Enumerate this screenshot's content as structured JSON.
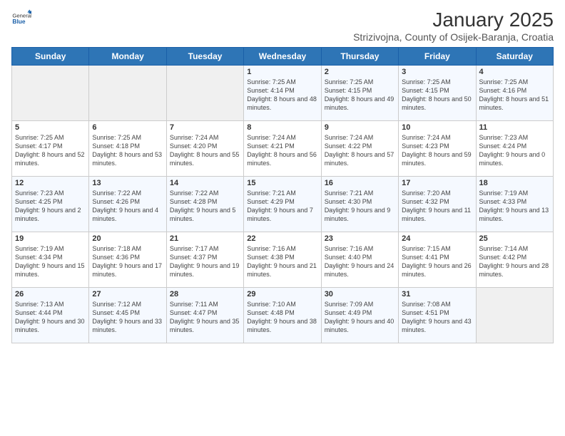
{
  "header": {
    "logo_general": "General",
    "logo_blue": "Blue",
    "month_title": "January 2025",
    "location": "Strizivojna, County of Osijek-Baranja, Croatia"
  },
  "days_of_week": [
    "Sunday",
    "Monday",
    "Tuesday",
    "Wednesday",
    "Thursday",
    "Friday",
    "Saturday"
  ],
  "weeks": [
    [
      {
        "day": "",
        "sunrise": "",
        "sunset": "",
        "daylight": ""
      },
      {
        "day": "",
        "sunrise": "",
        "sunset": "",
        "daylight": ""
      },
      {
        "day": "",
        "sunrise": "",
        "sunset": "",
        "daylight": ""
      },
      {
        "day": "1",
        "sunrise": "Sunrise: 7:25 AM",
        "sunset": "Sunset: 4:14 PM",
        "daylight": "Daylight: 8 hours and 48 minutes."
      },
      {
        "day": "2",
        "sunrise": "Sunrise: 7:25 AM",
        "sunset": "Sunset: 4:15 PM",
        "daylight": "Daylight: 8 hours and 49 minutes."
      },
      {
        "day": "3",
        "sunrise": "Sunrise: 7:25 AM",
        "sunset": "Sunset: 4:15 PM",
        "daylight": "Daylight: 8 hours and 50 minutes."
      },
      {
        "day": "4",
        "sunrise": "Sunrise: 7:25 AM",
        "sunset": "Sunset: 4:16 PM",
        "daylight": "Daylight: 8 hours and 51 minutes."
      }
    ],
    [
      {
        "day": "5",
        "sunrise": "Sunrise: 7:25 AM",
        "sunset": "Sunset: 4:17 PM",
        "daylight": "Daylight: 8 hours and 52 minutes."
      },
      {
        "day": "6",
        "sunrise": "Sunrise: 7:25 AM",
        "sunset": "Sunset: 4:18 PM",
        "daylight": "Daylight: 8 hours and 53 minutes."
      },
      {
        "day": "7",
        "sunrise": "Sunrise: 7:24 AM",
        "sunset": "Sunset: 4:20 PM",
        "daylight": "Daylight: 8 hours and 55 minutes."
      },
      {
        "day": "8",
        "sunrise": "Sunrise: 7:24 AM",
        "sunset": "Sunset: 4:21 PM",
        "daylight": "Daylight: 8 hours and 56 minutes."
      },
      {
        "day": "9",
        "sunrise": "Sunrise: 7:24 AM",
        "sunset": "Sunset: 4:22 PM",
        "daylight": "Daylight: 8 hours and 57 minutes."
      },
      {
        "day": "10",
        "sunrise": "Sunrise: 7:24 AM",
        "sunset": "Sunset: 4:23 PM",
        "daylight": "Daylight: 8 hours and 59 minutes."
      },
      {
        "day": "11",
        "sunrise": "Sunrise: 7:23 AM",
        "sunset": "Sunset: 4:24 PM",
        "daylight": "Daylight: 9 hours and 0 minutes."
      }
    ],
    [
      {
        "day": "12",
        "sunrise": "Sunrise: 7:23 AM",
        "sunset": "Sunset: 4:25 PM",
        "daylight": "Daylight: 9 hours and 2 minutes."
      },
      {
        "day": "13",
        "sunrise": "Sunrise: 7:22 AM",
        "sunset": "Sunset: 4:26 PM",
        "daylight": "Daylight: 9 hours and 4 minutes."
      },
      {
        "day": "14",
        "sunrise": "Sunrise: 7:22 AM",
        "sunset": "Sunset: 4:28 PM",
        "daylight": "Daylight: 9 hours and 5 minutes."
      },
      {
        "day": "15",
        "sunrise": "Sunrise: 7:21 AM",
        "sunset": "Sunset: 4:29 PM",
        "daylight": "Daylight: 9 hours and 7 minutes."
      },
      {
        "day": "16",
        "sunrise": "Sunrise: 7:21 AM",
        "sunset": "Sunset: 4:30 PM",
        "daylight": "Daylight: 9 hours and 9 minutes."
      },
      {
        "day": "17",
        "sunrise": "Sunrise: 7:20 AM",
        "sunset": "Sunset: 4:32 PM",
        "daylight": "Daylight: 9 hours and 11 minutes."
      },
      {
        "day": "18",
        "sunrise": "Sunrise: 7:19 AM",
        "sunset": "Sunset: 4:33 PM",
        "daylight": "Daylight: 9 hours and 13 minutes."
      }
    ],
    [
      {
        "day": "19",
        "sunrise": "Sunrise: 7:19 AM",
        "sunset": "Sunset: 4:34 PM",
        "daylight": "Daylight: 9 hours and 15 minutes."
      },
      {
        "day": "20",
        "sunrise": "Sunrise: 7:18 AM",
        "sunset": "Sunset: 4:36 PM",
        "daylight": "Daylight: 9 hours and 17 minutes."
      },
      {
        "day": "21",
        "sunrise": "Sunrise: 7:17 AM",
        "sunset": "Sunset: 4:37 PM",
        "daylight": "Daylight: 9 hours and 19 minutes."
      },
      {
        "day": "22",
        "sunrise": "Sunrise: 7:16 AM",
        "sunset": "Sunset: 4:38 PM",
        "daylight": "Daylight: 9 hours and 21 minutes."
      },
      {
        "day": "23",
        "sunrise": "Sunrise: 7:16 AM",
        "sunset": "Sunset: 4:40 PM",
        "daylight": "Daylight: 9 hours and 24 minutes."
      },
      {
        "day": "24",
        "sunrise": "Sunrise: 7:15 AM",
        "sunset": "Sunset: 4:41 PM",
        "daylight": "Daylight: 9 hours and 26 minutes."
      },
      {
        "day": "25",
        "sunrise": "Sunrise: 7:14 AM",
        "sunset": "Sunset: 4:42 PM",
        "daylight": "Daylight: 9 hours and 28 minutes."
      }
    ],
    [
      {
        "day": "26",
        "sunrise": "Sunrise: 7:13 AM",
        "sunset": "Sunset: 4:44 PM",
        "daylight": "Daylight: 9 hours and 30 minutes."
      },
      {
        "day": "27",
        "sunrise": "Sunrise: 7:12 AM",
        "sunset": "Sunset: 4:45 PM",
        "daylight": "Daylight: 9 hours and 33 minutes."
      },
      {
        "day": "28",
        "sunrise": "Sunrise: 7:11 AM",
        "sunset": "Sunset: 4:47 PM",
        "daylight": "Daylight: 9 hours and 35 minutes."
      },
      {
        "day": "29",
        "sunrise": "Sunrise: 7:10 AM",
        "sunset": "Sunset: 4:48 PM",
        "daylight": "Daylight: 9 hours and 38 minutes."
      },
      {
        "day": "30",
        "sunrise": "Sunrise: 7:09 AM",
        "sunset": "Sunset: 4:49 PM",
        "daylight": "Daylight: 9 hours and 40 minutes."
      },
      {
        "day": "31",
        "sunrise": "Sunrise: 7:08 AM",
        "sunset": "Sunset: 4:51 PM",
        "daylight": "Daylight: 9 hours and 43 minutes."
      },
      {
        "day": "",
        "sunrise": "",
        "sunset": "",
        "daylight": ""
      }
    ]
  ]
}
